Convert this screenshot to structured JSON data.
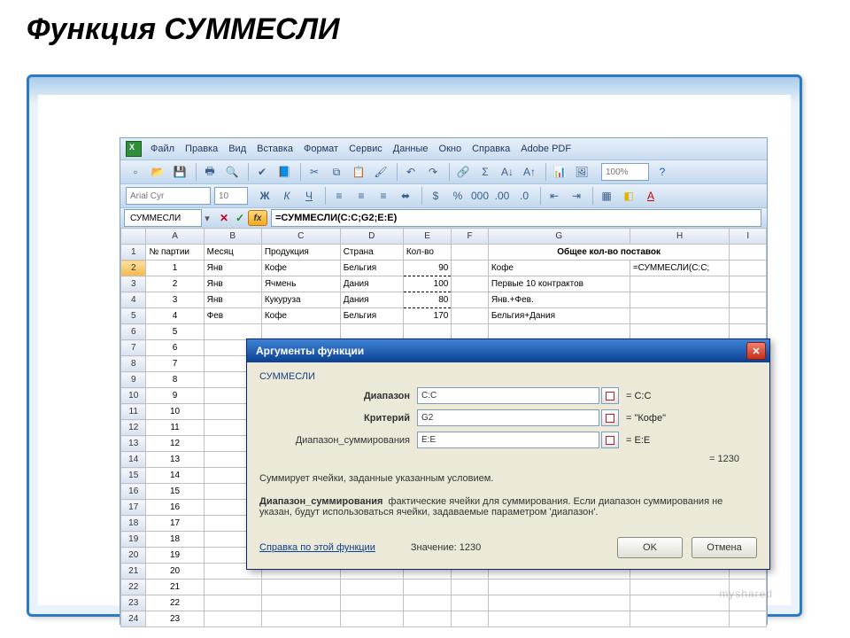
{
  "title": "Функция СУММЕСЛИ",
  "menu": {
    "file": "Файл",
    "edit": "Правка",
    "view": "Вид",
    "insert": "Вставка",
    "format": "Формат",
    "service": "Сервис",
    "data": "Данные",
    "window": "Окно",
    "help": "Справка",
    "pdf": "Adobe PDF"
  },
  "font": {
    "name": "Arial Cyr",
    "size": "10"
  },
  "zoom": "100%",
  "formulabar": {
    "name": "СУММЕСЛИ",
    "formula": "=СУММЕСЛИ(C:C;G2;E:E)"
  },
  "columns": [
    "A",
    "B",
    "C",
    "D",
    "E",
    "F",
    "G",
    "H",
    "I"
  ],
  "headers": {
    "A": "№ партии",
    "B": "Месяц",
    "C": "Продукция",
    "D": "Страна",
    "E": "Кол-во",
    "GH": "Общее кол-во поставок"
  },
  "rows": [
    {
      "n": "1",
      "A": "№ партии",
      "B": "Месяц",
      "C": "Продукция",
      "D": "Страна",
      "E": "Кол-во",
      "G": "Общее кол-во поставок",
      "H": ""
    },
    {
      "n": "2",
      "A": "1",
      "B": "Янв",
      "C": "Кофе",
      "D": "Бельгия",
      "E": "90",
      "G": "Кофе",
      "H": "=СУММЕСЛИ(C:C;"
    },
    {
      "n": "3",
      "A": "2",
      "B": "Янв",
      "C": "Ячмень",
      "D": "Дания",
      "E": "100",
      "G": "Первые 10 контрактов",
      "H": ""
    },
    {
      "n": "4",
      "A": "3",
      "B": "Янв",
      "C": "Кукуруза",
      "D": "Дания",
      "E": "80",
      "G": "Янв.+Фев.",
      "H": ""
    },
    {
      "n": "5",
      "A": "4",
      "B": "Фев",
      "C": "Кофе",
      "D": "Бельгия",
      "E": "170",
      "G": "Бельгия+Дания",
      "H": ""
    }
  ],
  "extraRows": [
    "6",
    "7",
    "8",
    "9",
    "10",
    "11",
    "12",
    "13",
    "14",
    "15",
    "16",
    "17",
    "18",
    "19",
    "20",
    "21",
    "22",
    "23",
    "24"
  ],
  "extraA": {
    "6": "5",
    "7": "6",
    "8": "7",
    "9": "8",
    "10": "9",
    "11": "10",
    "12": "11",
    "13": "12",
    "14": "13",
    "15": "14",
    "16": "15",
    "17": "16",
    "18": "17",
    "19": "18",
    "20": "19",
    "21": "20",
    "22": "21",
    "23": "22",
    "24": "23"
  },
  "dialog": {
    "title": "Аргументы функции",
    "func": "СУММЕСЛИ",
    "args": [
      {
        "label": "Диапазон",
        "bold": true,
        "value": "C:C",
        "result": "= C:C"
      },
      {
        "label": "Критерий",
        "bold": true,
        "value": "G2",
        "result": "= \"Кофе\""
      },
      {
        "label": "Диапазон_суммирования",
        "bold": false,
        "value": "E:E",
        "result": "= E:E"
      }
    ],
    "total": "= 1230",
    "desc": "Суммирует ячейки, заданные указанным условием.",
    "argname": "Диапазон_суммирования",
    "argdesc": "фактические ячейки для суммирования. Если диапазон суммирования не указан, будут использоваться ячейки, задаваемые параметром 'диапазон'.",
    "help": "Справка по этой функции",
    "valuelabel": "Значение:",
    "value": "1230",
    "ok": "OK",
    "cancel": "Отмена"
  },
  "watermark": "myshared"
}
